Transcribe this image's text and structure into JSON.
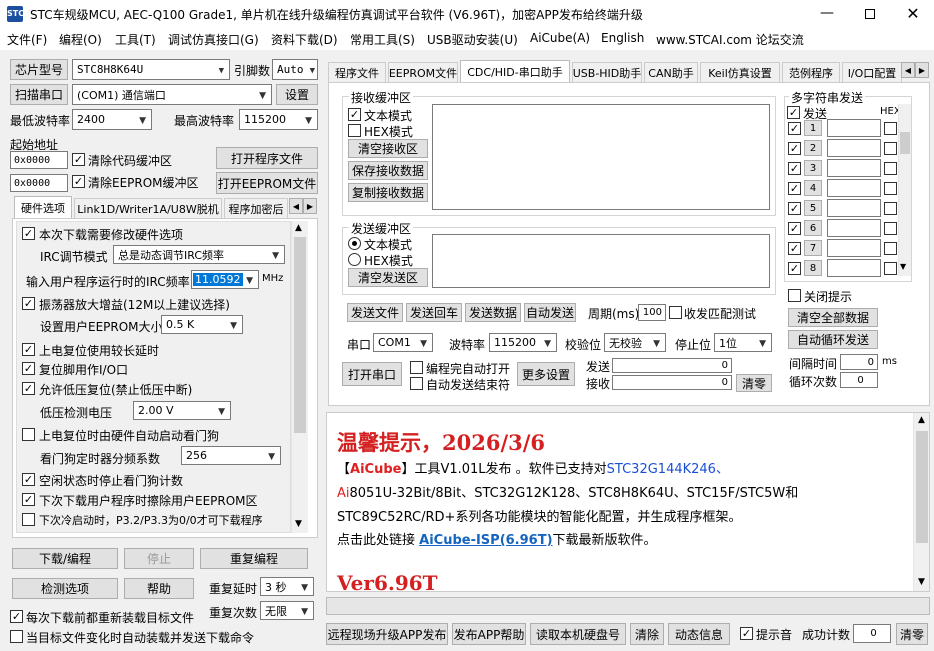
{
  "title": "STC车规级MCU, AEC-Q100 Grade1, 单片机在线升级编程仿真调试平台软件 (V6.96T)，加密APP发布给终端升级",
  "menu": [
    "文件(F)",
    "编程(O)",
    "工具(T)",
    "调试仿真接口(G)",
    "资料下载(D)",
    "常用工具(S)",
    "USB驱动安装(U)",
    "AiCube(A)",
    "English",
    "www.STCAI.com 论坛交流"
  ],
  "left": {
    "chip_btn": "芯片型号",
    "chip_value": "STC8H8K64U",
    "pin_label": "引脚数",
    "pin_value": "Auto",
    "scan_btn": "扫描串口",
    "port_value": "(COM1) 通信端口",
    "settings_btn": "设置",
    "min_baud_label": "最低波特率",
    "min_baud": "2400",
    "max_baud_label": "最高波特率",
    "max_baud": "115200",
    "start_addr_label": "起始地址",
    "addr1": "0x0000",
    "clear_code": "清除代码缓冲区",
    "open_prog": "打开程序文件",
    "addr2": "0x0000",
    "clear_eeprom": "清除EEPROM缓冲区",
    "open_eeprom": "打开EEPROM文件",
    "tabs": [
      "硬件选项",
      "Link1D/Writer1A/U8W脱机",
      "程序加密后"
    ],
    "hw": {
      "opt1": "本次下载需要修改硬件选项",
      "irc_mode_label": "IRC调节模式",
      "irc_mode_value": "总是动态调节IRC频率",
      "irc_freq_label": "输入用户程序运行时的IRC频率",
      "irc_freq_value": "11.0592",
      "mhz": "MHz",
      "opt2": "振荡器放大增益(12M以上建议选择)",
      "eeprom_label": "设置用户EEPROM大小",
      "eeprom_value": "0.5 K",
      "opt3": "上电复位使用较长延时",
      "opt4": "复位脚用作I/O口",
      "opt5": "允许低压复位(禁止低压中断)",
      "lvd_label": "低压检测电压",
      "lvd_value": "2.00 V",
      "opt6": "上电复位时由硬件自动启动看门狗",
      "wdt_label": "看门狗定时器分频系数",
      "wdt_value": "256",
      "opt7": "空闲状态时停止看门狗计数",
      "opt8": "下次下载用户程序时擦除用户EEPROM区",
      "opt9": "下次冷启动时，P3.2/P3.3为0/0才可下载程序"
    },
    "download_btn": "下载/编程",
    "stop_btn": "停止",
    "reprog_btn": "重复编程",
    "check_btn": "检测选项",
    "help_btn": "帮助",
    "delay_label": "重复延时",
    "delay_value": "3 秒",
    "count_label": "重复次数",
    "count_value": "无限",
    "reload_cb": "每次下载前都重新装载目标文件",
    "auto_cb": "当目标文件变化时自动装载并发送下载命令"
  },
  "right": {
    "tabs": [
      "程序文件",
      "EEPROM文件",
      "CDC/HID-串口助手",
      "USB-HID助手",
      "CAN助手",
      "Keil仿真设置",
      "范例程序",
      "I/O口配置"
    ],
    "rx": {
      "title": "接收缓冲区",
      "text_mode": "文本模式",
      "hex_mode": "HEX模式",
      "clear": "清空接收区",
      "save": "保存接收数据",
      "copy": "复制接收数据"
    },
    "tx": {
      "title": "发送缓冲区",
      "text_mode": "文本模式",
      "hex_mode": "HEX模式",
      "clear": "清空发送区"
    },
    "tx_buttons": [
      "发送文件",
      "发送回车",
      "发送数据",
      "自动发送"
    ],
    "period_label": "周期(ms)",
    "period_value": "100",
    "match_test": "收发匹配测试",
    "multi": {
      "title": "多字符串发送",
      "send": "发送",
      "hex": "HEX",
      "rows": [
        "1",
        "2",
        "3",
        "4",
        "5",
        "6",
        "7",
        "8"
      ],
      "close_hint": "关闭提示",
      "clear_all": "清空全部数据",
      "auto_loop": "自动循环发送",
      "interval_label": "间隔时间",
      "interval_value": "0",
      "ms": "ms",
      "loop_label": "循环次数",
      "loop_value": "0"
    },
    "serial_label": "串口",
    "serial_value": "COM1",
    "baud_label": "波特率",
    "baud_value": "115200",
    "parity_label": "校验位",
    "parity_value": "无校验",
    "stop_label": "停止位",
    "stop_value": "1位",
    "open_port": "打开串口",
    "auto_open": "编程完自动打开",
    "auto_send_end": "自动发送结束符",
    "more_settings": "更多设置",
    "send_label": "发送",
    "send_count": "0",
    "recv_label": "接收",
    "recv_count": "0",
    "clear_zero": "清零"
  },
  "notice": {
    "title": "温馨提示，2026/3/6",
    "l1a": "【",
    "l1b": "AiCube",
    "l1c": "】工具V1.01L发布 。软件已支持对",
    "l1d": "STC32G144K246、",
    "l2a": "Ai",
    "l2b": "8051U-32Bit/8Bit、STC32G12K128、STC8H8K64U、STC15F/STC5W和",
    "l3": "STC89C52RC/RD+系列各功能模块的智能化配置，并生成程序框架。",
    "l4a": "点击此处链接 ",
    "l4b": "AiCube-ISP(6.96T)",
    "l4c": "下载最新版软件。",
    "l5": "Ver6.96T"
  },
  "bottom": {
    "buttons": [
      "远程现场升级APP发布",
      "发布APP帮助",
      "读取本机硬盘号",
      "清除",
      "动态信息"
    ],
    "beep": "提示音",
    "success_label": "成功计数",
    "success_value": "0",
    "clear_btn": "清零"
  },
  "colors": {
    "red": "#e02020",
    "blue": "#1a4fd6",
    "link": "#1565c0",
    "title_red": "#d42020"
  }
}
